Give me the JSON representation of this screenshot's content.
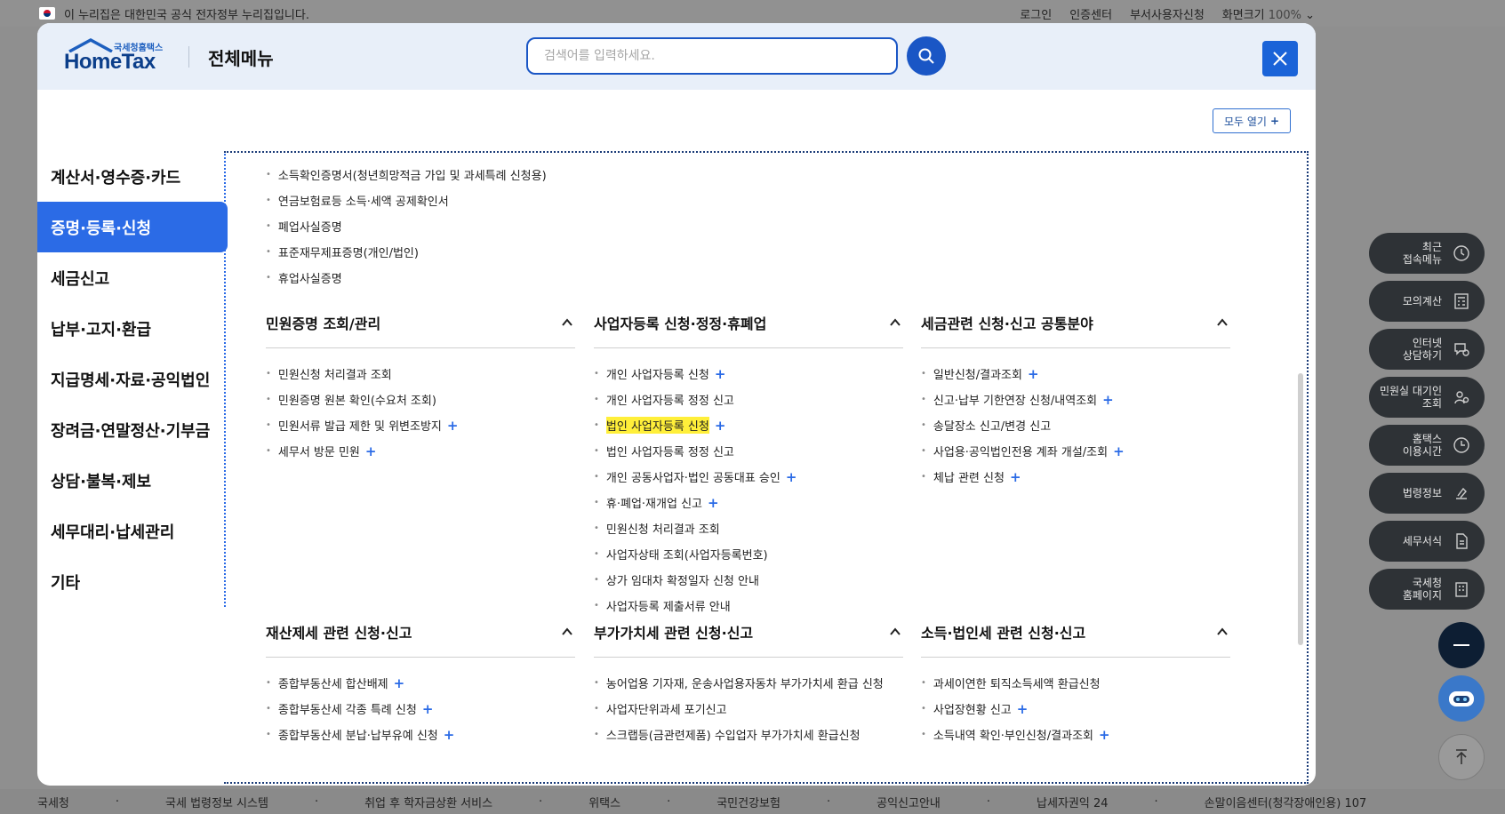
{
  "gov_banner": {
    "text": "이 누리집은 대한민국 공식 전자정부 누리집입니다.",
    "links": [
      "로그인",
      "인증센터",
      "부서사용자신청",
      "화면크기"
    ],
    "zoom": "100%"
  },
  "header": {
    "logo_small": "국세청홈택스",
    "logo_main": "HomeTax",
    "title": "전체메뉴",
    "search_placeholder": "검색어를 입력하세요.",
    "open_all_label": "모두 열기"
  },
  "sidebar": {
    "items": [
      {
        "label": "계산서·영수증·카드",
        "active": false
      },
      {
        "label": "증명·등록·신청",
        "active": true
      },
      {
        "label": "세금신고",
        "active": false
      },
      {
        "label": "납부·고지·환급",
        "active": false
      },
      {
        "label": "지급명세·자료·공익법인",
        "active": false
      },
      {
        "label": "장려금·연말정산·기부금",
        "active": false
      },
      {
        "label": "상담·불복·제보",
        "active": false
      },
      {
        "label": "세무대리·납세관리",
        "active": false
      },
      {
        "label": "기타",
        "active": false
      }
    ]
  },
  "top_list": [
    "소득확인증명서(청년희망적금 가입 및 과세특례 신청용)",
    "연금보험료등 소득·세액 공제확인서",
    "폐업사실증명",
    "표준재무제표증명(개인/법인)",
    "휴업사실증명"
  ],
  "sections": [
    {
      "title": "민원증명 조회/관리",
      "items": [
        {
          "text": "민원신청 처리결과 조회",
          "plus": false
        },
        {
          "text": "민원증명 원본 확인(수요처 조회)",
          "plus": false
        },
        {
          "text": "민원서류 발급 제한 및 위변조방지",
          "plus": true
        },
        {
          "text": "세무서 방문 민원",
          "plus": true
        }
      ]
    },
    {
      "title": "사업자등록 신청·정정·휴폐업",
      "items": [
        {
          "text": "개인 사업자등록 신청",
          "plus": true
        },
        {
          "text": "개인 사업자등록 정정 신고",
          "plus": false
        },
        {
          "text": "법인 사업자등록 신청",
          "plus": true,
          "highlight": true
        },
        {
          "text": "법인 사업자등록 정정 신고",
          "plus": false
        },
        {
          "text": "개인 공동사업자·법인 공동대표 승인",
          "plus": true
        },
        {
          "text": "휴·폐업·재개업 신고",
          "plus": true
        },
        {
          "text": "민원신청 처리결과 조회",
          "plus": false
        },
        {
          "text": "사업자상태 조회(사업자등록번호)",
          "plus": false
        },
        {
          "text": "상가 임대차 확정일자 신청 안내",
          "plus": false
        },
        {
          "text": "사업자등록 제출서류 안내",
          "plus": false
        }
      ]
    },
    {
      "title": "세금관련 신청·신고 공통분야",
      "items": [
        {
          "text": "일반신청/결과조회",
          "plus": true
        },
        {
          "text": "신고·납부 기한연장 신청/내역조회",
          "plus": true
        },
        {
          "text": "송달장소 신고/변경 신고",
          "plus": false
        },
        {
          "text": "사업용·공익법인전용 계좌 개설/조회",
          "plus": true
        },
        {
          "text": "체납 관련 신청",
          "plus": true
        }
      ]
    },
    {
      "title": "재산제세 관련 신청·신고",
      "items": [
        {
          "text": "종합부동산세 합산배제",
          "plus": true
        },
        {
          "text": "종합부동산세 각종 특례 신청",
          "plus": true
        },
        {
          "text": "종합부동산세 분납·납부유예 신청",
          "plus": true
        }
      ]
    },
    {
      "title": "부가가치세 관련 신청·신고",
      "items": [
        {
          "text": "농어업용 기자재, 운송사업용자동차 부가가치세 환급 신청",
          "plus": false
        },
        {
          "text": "사업자단위과세 포기신고",
          "plus": false
        },
        {
          "text": "스크랩등(금관련제품) 수입업자 부가가치세 환급신청",
          "plus": false
        }
      ]
    },
    {
      "title": "소득·법인세 관련 신청·신고",
      "items": [
        {
          "text": "과세이연한 퇴직소득세액 환급신청",
          "plus": false
        },
        {
          "text": "사업장현황 신고",
          "plus": true
        },
        {
          "text": "소득내역 확인·부인신청/결과조회",
          "plus": true
        }
      ]
    }
  ],
  "float_menu": [
    {
      "label": "최근\n접속메뉴",
      "icon": "clock-icon"
    },
    {
      "label": "모의계산",
      "icon": "calculator-icon"
    },
    {
      "label": "인터넷\n상담하기",
      "icon": "chat-icon"
    },
    {
      "label": "민원실 대기인\n조회",
      "icon": "people-search-icon"
    },
    {
      "label": "홈택스\n이용시간",
      "icon": "time-icon"
    },
    {
      "label": "법령정보",
      "icon": "law-icon"
    },
    {
      "label": "세무서식",
      "icon": "document-icon"
    },
    {
      "label": "국세청\n홈페이지",
      "icon": "building-icon"
    }
  ],
  "footer_links": [
    "국세청",
    "국세 법령정보 시스템",
    "취업 후 학자금상환 서비스",
    "위택스",
    "국민건강보험",
    "공익신고안내",
    "납세자권익 24",
    "손말이음센터(청각장애인용) 107"
  ],
  "colors": {
    "primary": "#2b6be6",
    "header_bg": "#e8eff9",
    "highlight": "#ffef3a"
  }
}
